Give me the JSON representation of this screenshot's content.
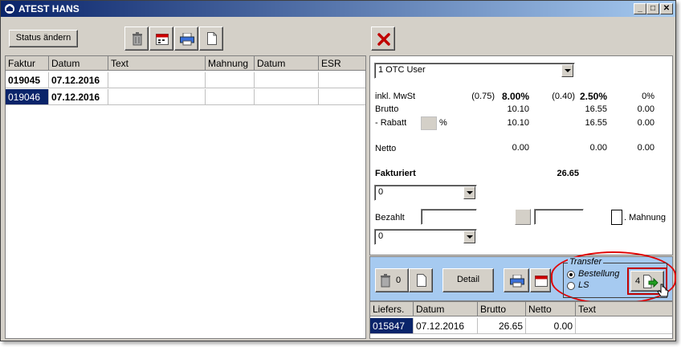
{
  "window": {
    "title": "ATEST HANS"
  },
  "toolbar": {
    "status_label": "Status ändern"
  },
  "invoices": {
    "columns": [
      "Faktur",
      "Datum",
      "Text",
      "Mahnung",
      "Datum",
      "ESR"
    ],
    "rows": [
      {
        "faktur": "019045",
        "datum": "07.12.2016"
      },
      {
        "faktur": "019046",
        "datum": "07.12.2016"
      }
    ]
  },
  "details": {
    "user_select": "1  OTC User",
    "mwst_label": "inkl. MwSt",
    "tax1_amount": "(0.75)",
    "tax1_rate": "8.00%",
    "tax2_amount": "(0.40)",
    "tax2_rate": "2.50%",
    "tax3_rate": "0%",
    "brutto_label": "Brutto",
    "brutto_values": [
      "10.10",
      "16.55",
      "0.00"
    ],
    "rabatt_label": "- Rabatt",
    "rabatt_unit": "%",
    "rabatt_values": [
      "10.10",
      "16.55",
      "0.00"
    ],
    "netto_label": "Netto",
    "netto_values": [
      "0.00",
      "0.00",
      "0.00"
    ],
    "fakturiert_label": "Fakturiert",
    "fakturiert_value": "26.65",
    "combo1_value": "0",
    "bezahlt_label": "Bezahlt",
    "mahnung_label": ". Mahnung",
    "combo2_value": "0"
  },
  "bottom": {
    "trash_count": "0",
    "detail_label": "Detail",
    "transfer_title": "Transfer",
    "radio_bestellung": "Bestellung",
    "radio_ls": "LS",
    "transfer_count": "4"
  },
  "deliveries": {
    "columns": [
      "Liefers.",
      "Datum",
      "Brutto",
      "Netto",
      "Text"
    ],
    "rows": [
      {
        "liefers": "015847",
        "datum": "07.12.2016",
        "brutto": "26.65",
        "netto": "0.00",
        "text": ""
      }
    ]
  },
  "colors": {
    "selection": "#0a246a",
    "highlight": "#e00000",
    "panel_blue": "#a6caf0"
  }
}
